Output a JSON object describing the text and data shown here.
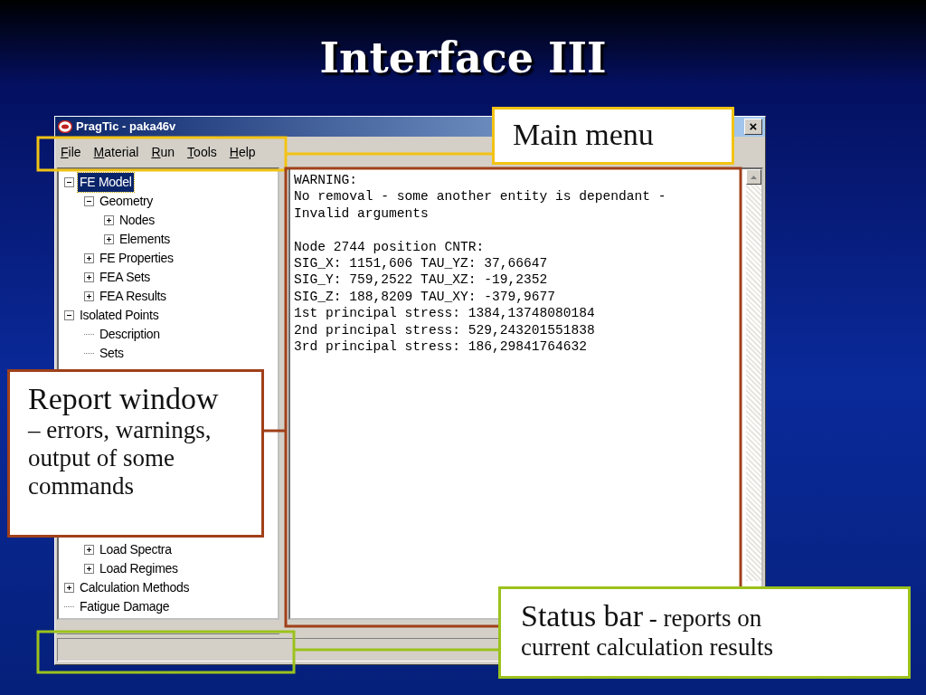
{
  "slide_title": "Interface III",
  "window": {
    "title": "PragTic - paka46v",
    "close": "×"
  },
  "menu": [
    "File",
    "Material",
    "Run",
    "Tools",
    "Help"
  ],
  "tree": [
    {
      "label": "FE Model",
      "expanded": true,
      "selected": true,
      "children": [
        {
          "label": "Geometry",
          "expanded": true,
          "selected": false,
          "children": [
            {
              "label": "Nodes",
              "expanded": false,
              "selected": false
            },
            {
              "label": "Elements",
              "expanded": false,
              "selected": false
            }
          ]
        },
        {
          "label": "FE Properties",
          "expanded": false,
          "selected": false
        },
        {
          "label": "FEA Sets",
          "expanded": false,
          "selected": false
        },
        {
          "label": "FEA Results",
          "expanded": false,
          "selected": false
        }
      ]
    },
    {
      "label": "Isolated Points",
      "expanded": true,
      "selected": false,
      "children": [
        {
          "label": "Description",
          "selected": false
        },
        {
          "label": "Sets",
          "selected": false
        }
      ]
    },
    {
      "children": [
        {
          "children": [
            {
              "label": "Load Spectra",
              "expanded": false,
              "selected": false
            },
            {
              "label": "Load Regimes",
              "expanded": false,
              "selected": false
            }
          ]
        },
        {
          "label": "Calculation Methods",
          "expanded": false,
          "selected": false
        },
        {
          "label": "Fatigue Damage",
          "selected": false
        }
      ]
    }
  ],
  "report": [
    [
      "WARNING:",
      "No removal - some another entity is dependant -",
      "Invalid arguments"
    ],
    [
      "Node 2744 position CNTR:",
      "SIG_X: 1151,606 TAU_YZ: 37,66647",
      "SIG_Y: 759,2522 TAU_XZ: -19,2352",
      "SIG_Z: 188,8209 TAU_XY: -379,9677",
      "1st principal stress: 1384,13748080184",
      "2nd principal stress: 529,243201551838",
      "3rd principal stress: 186,29841764632"
    ]
  ],
  "callouts": [
    {
      "kind": "menu",
      "color": "#f2c314",
      "lead": "Main menu"
    },
    {
      "kind": "report",
      "color": "#a0401a",
      "lead": "Report window",
      "text": "– errors, warnings, output of some commands"
    },
    {
      "kind": "status",
      "color": "#9bc21c",
      "lead": "Status bar",
      "text": "- reports on current calculation results"
    }
  ]
}
